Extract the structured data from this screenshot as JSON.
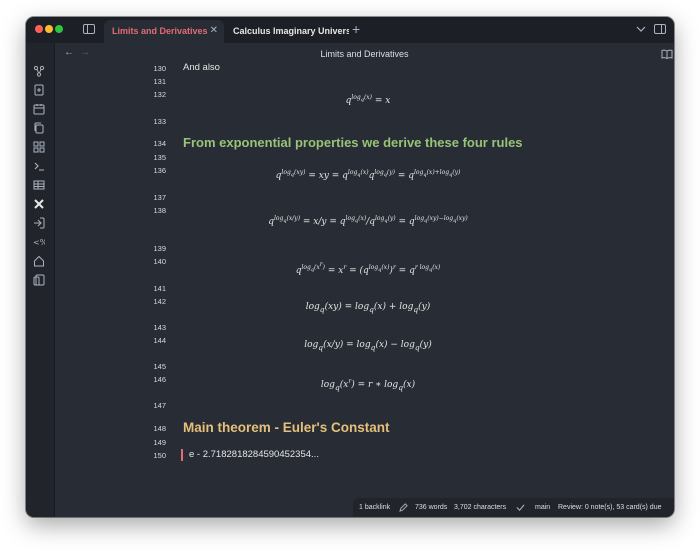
{
  "tabs": {
    "active": "Limits and Derivatives",
    "inactive": "Calculus Imaginary Univers...",
    "add": "+"
  },
  "header": {
    "title": "Limits and Derivatives",
    "more": "···"
  },
  "lines": {
    "n130": "130",
    "n131": "131",
    "n132": "132",
    "n133": "133",
    "n134": "134",
    "n135": "135",
    "n136": "136",
    "n137": "137",
    "n138": "138",
    "n139": "139",
    "n140": "140",
    "n141": "141",
    "n142": "142",
    "n143": "143",
    "n144": "144",
    "n145": "145",
    "n146": "146",
    "n147": "147",
    "n148": "148",
    "n149": "149",
    "n150": "150"
  },
  "content": {
    "and_also": "And also",
    "heading_rules": "From exponential properties we derive these four rules",
    "heading_theorem": "Main theorem - Euler's Constant",
    "euler_line": "e - 2.7182818284590452354..."
  },
  "status": {
    "backlinks": "1 backlink",
    "words": "736 words",
    "characters": "3,702 characters",
    "branch": "main",
    "review": "Review: 0 note(s), 53 card(s) due"
  },
  "colors": {
    "background": "#282c34",
    "heading_green": "#98c379",
    "heading_yellow": "#e5c07b",
    "active_tab": "#e06c75"
  }
}
